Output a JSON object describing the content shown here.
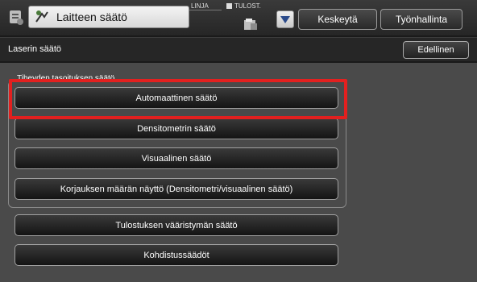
{
  "topbar": {
    "title": "Laitteen säätö",
    "line_label": "LINJA",
    "print_label": "TULOST.",
    "stop_label": "Keskeytä",
    "jobs_label": "Työnhallinta"
  },
  "header": {
    "page_title": "Laserin säätö",
    "back_label": "Edellinen"
  },
  "group": {
    "label": "Tiheyden tasoituksen säätö",
    "buttons": [
      "Automaattinen säätö",
      "Densitometrin säätö",
      "Visuaalinen säätö",
      "Korjauksen määrän näyttö (Densitometri/visuaalinen säätö)"
    ]
  },
  "other_buttons": [
    "Tulostuksen vääristymän säätö",
    "Kohdistussäädöt"
  ],
  "colors": {
    "highlight": "#e3201f"
  }
}
